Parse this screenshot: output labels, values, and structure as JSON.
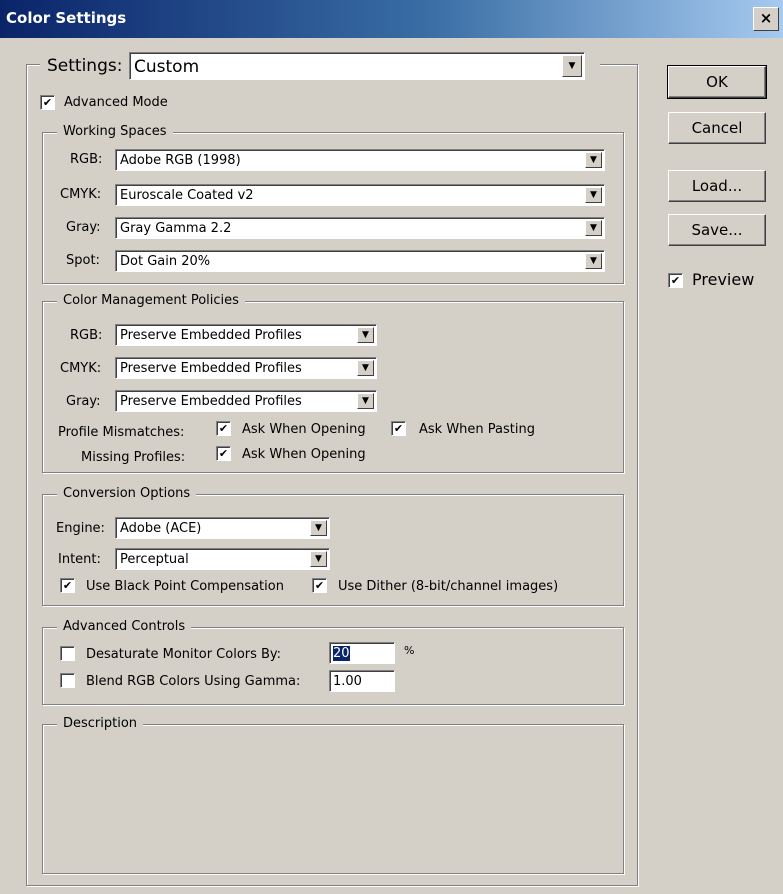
{
  "window": {
    "title": "Color Settings",
    "close": "×"
  },
  "settings": {
    "label": "Settings:",
    "value": "Custom"
  },
  "advanced_mode": {
    "label": "Advanced Mode",
    "checked": true
  },
  "working_spaces": {
    "legend": "Working Spaces",
    "rows": [
      {
        "label": "RGB:",
        "value": "Adobe RGB (1998)"
      },
      {
        "label": "CMYK:",
        "value": "Euroscale Coated v2"
      },
      {
        "label": "Gray:",
        "value": "Gray Gamma 2.2"
      },
      {
        "label": "Spot:",
        "value": "Dot Gain 20%"
      }
    ]
  },
  "policies": {
    "legend": "Color Management Policies",
    "rows": [
      {
        "label": "RGB:",
        "value": "Preserve Embedded Profiles"
      },
      {
        "label": "CMYK:",
        "value": "Preserve Embedded Profiles"
      },
      {
        "label": "Gray:",
        "value": "Preserve Embedded Profiles"
      }
    ],
    "mismatch_label": "Profile Mismatches:",
    "ask_opening": "Ask When Opening",
    "ask_pasting": "Ask When Pasting",
    "missing_label": "Missing Profiles:",
    "missing_ask_opening": "Ask When Opening"
  },
  "conversion": {
    "legend": "Conversion Options",
    "engine_label": "Engine:",
    "engine_value": "Adobe (ACE)",
    "intent_label": "Intent:",
    "intent_value": "Perceptual",
    "bpc_label": "Use Black Point Compensation",
    "dither_label": "Use Dither (8-bit/channel images)"
  },
  "advanced_controls": {
    "legend": "Advanced Controls",
    "desaturate_label": "Desaturate Monitor Colors By:",
    "desaturate_value": "20",
    "percent": "%",
    "blend_label": "Blend RGB Colors Using Gamma:",
    "blend_value": "1.00"
  },
  "description": {
    "legend": "Description"
  },
  "buttons": {
    "ok": "OK",
    "cancel": "Cancel",
    "load": "Load...",
    "save": "Save..."
  },
  "preview": {
    "label": "Preview",
    "checked": true
  },
  "check_glyph": "✔",
  "dropdown_glyph": "▼"
}
